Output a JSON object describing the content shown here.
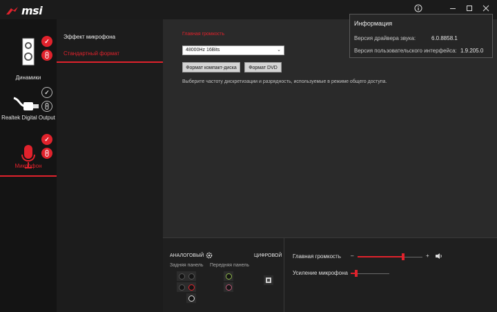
{
  "app": {
    "logo": "msi"
  },
  "window": {
    "info_icon": "info-icon",
    "minimize_icon": "minimize-icon",
    "maximize_icon": "maximize-icon",
    "close_icon": "close-icon"
  },
  "devices": [
    {
      "label": "Динамики",
      "icon": "speaker-icon"
    },
    {
      "label": "Realtek Digital Output",
      "icon": "digital-cable-icon"
    },
    {
      "label": "Микрофон",
      "icon": "microphone-icon"
    }
  ],
  "submenu": {
    "items": [
      "Эффект микрофона",
      "Стандартный формат"
    ]
  },
  "main": {
    "section_title": "Главная громкость",
    "format_value": "48000Hz 16Bits",
    "buttons": {
      "cd": "Формат компакт-диска",
      "dvd": "Формат DVD"
    },
    "hint": "Выберите частоту дискретизации и разрядность, используемые в режиме общего доступа."
  },
  "info": {
    "title": "Информация",
    "driver_label": "Версия драйвера звука:",
    "driver_value": "6.0.8858.1",
    "ui_label": "Версия пользовательского интерфейса:",
    "ui_value": "1.9.205.0"
  },
  "jacks": {
    "analog": "АНАЛОГОВЫЙ",
    "digital": "ЦИФРОВОЙ",
    "rear": "Задняя панель",
    "front": "Передняя панель"
  },
  "levels": {
    "volume_label": "Главная громкость",
    "volume_value": 0.7,
    "minus": "–",
    "plus": "+",
    "mic_boost_label": "Усиление микрофона",
    "mic_boost_value": 0.15
  },
  "colors": {
    "accent": "#e1222c",
    "background": "#1e1e1e"
  }
}
